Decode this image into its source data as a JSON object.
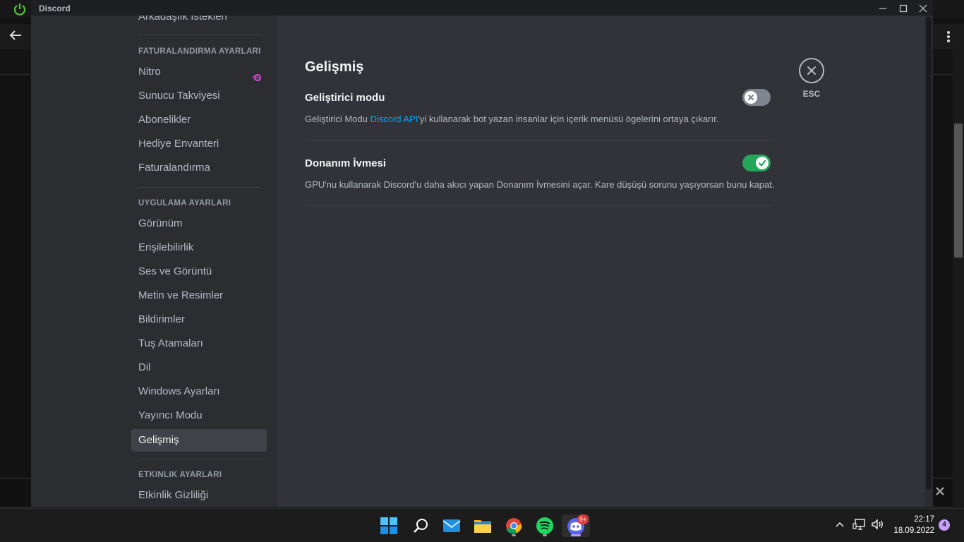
{
  "window": {
    "title": "Discord"
  },
  "sidebar": {
    "top_partial_item": "Arkadaşlık İstekleri",
    "billing_header": "FATURALANDIRMA AYARLARI",
    "billing_items": [
      "Nitro",
      "Sunucu Takviyesi",
      "Abonelikler",
      "Hediye Envanteri",
      "Faturalandırma"
    ],
    "app_header": "UYGULAMA AYARLARI",
    "app_items": [
      "Görünüm",
      "Erişilebilirlik",
      "Ses ve Görüntü",
      "Metin ve Resimler",
      "Bildirimler",
      "Tuş Atamaları",
      "Dil",
      "Windows Ayarları",
      "Yayıncı Modu",
      "Gelişmiş"
    ],
    "activity_header": "ETKİNLİK AYARLARI",
    "activity_items": [
      "Etkinlik Gizliliği"
    ],
    "active_item": "Gelişmiş"
  },
  "main": {
    "title": "Gelişmiş",
    "settings": [
      {
        "title": "Geliştirici modu",
        "desc_before": "Geliştirici Modu ",
        "desc_link": "Discord API",
        "desc_after": "'yi kullanarak bot yazan insanlar için içerik menüsü ögelerini ortaya çıkarır.",
        "enabled": false
      },
      {
        "title": "Donanım İvmesi",
        "desc_before": "GPU'nu kullanarak Discord'u daha akıcı yapan Donanım İvmesini açar. Kare düşüşü sorunu yaşıyorsan bunu kapat.",
        "desc_link": "",
        "desc_after": "",
        "enabled": true
      }
    ],
    "close_label": "ESC"
  },
  "taskbar": {
    "apps": [
      "start",
      "search",
      "mail",
      "file-explorer",
      "chrome",
      "spotify",
      "discord"
    ],
    "discord_badge": "9+",
    "time": "22:17",
    "date": "18.09.2022",
    "notification_count": "4"
  },
  "colors": {
    "accent_link": "#00a8fc",
    "toggle_on": "#23a55a",
    "toggle_off": "#80848e",
    "nitro": "#e04ae0"
  }
}
